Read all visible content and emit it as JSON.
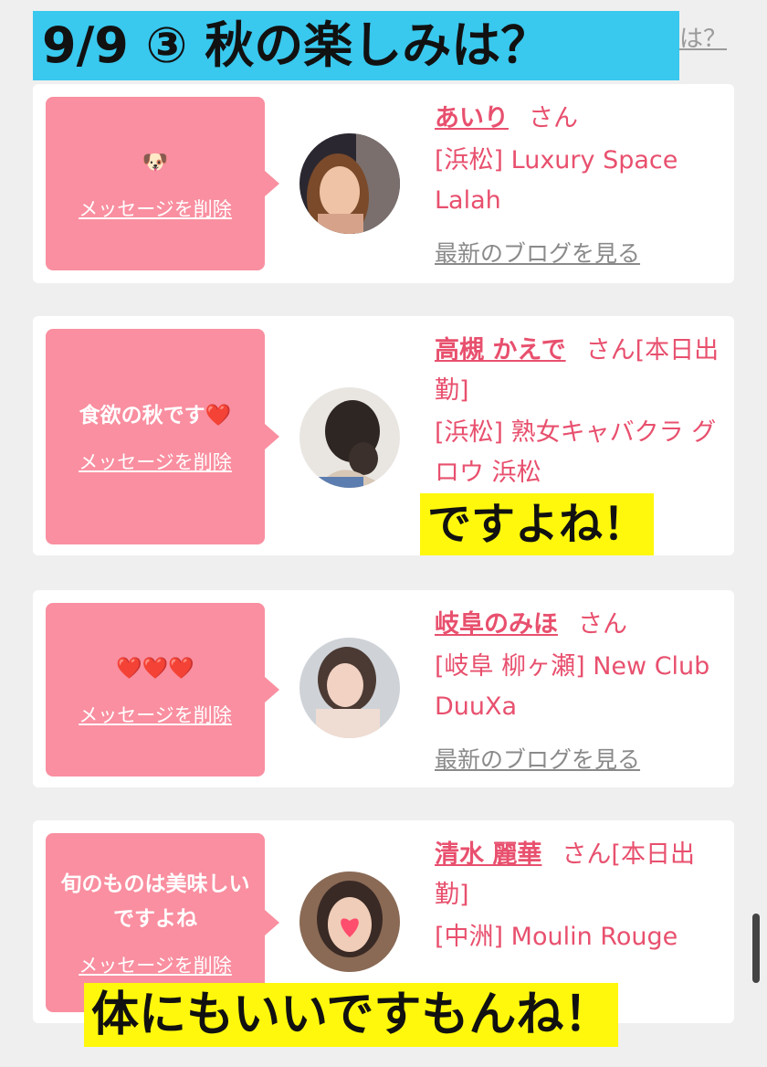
{
  "title_banner": "9/9 ③ 秋の楽しみは？",
  "background_text": "は？",
  "entries": [
    {
      "message": "🐶",
      "delete_label": "メッセージを削除",
      "name": "あいり",
      "honorific": "さん",
      "shop": "[浜松] Luxury Space Lalah",
      "blog_link": "最新のブログを見る"
    },
    {
      "message": "食欲の秋です❤️",
      "delete_label": "メッセージを削除",
      "name": "高槻 かえで",
      "honorific": "さん[本日出勤]",
      "shop": "[浜松] 熟女キャバクラ グロウ 浜松",
      "blog_link": ""
    },
    {
      "message": "❤️❤️❤️",
      "delete_label": "メッセージを削除",
      "name": "岐阜のみほ",
      "honorific": "さん",
      "shop": "[岐阜 柳ヶ瀬] New Club DuuXa",
      "blog_link": "最新のブログを見る"
    },
    {
      "message": "旬のものは美味しいですよね",
      "delete_label": "メッセージを削除",
      "name": "清水 麗華",
      "honorific": "さん[本日出勤]",
      "shop": "[中洲] Moulin Rouge",
      "blog_link": ""
    }
  ],
  "captions": {
    "top": "ですよね！",
    "bottom": "体にもいいですもんね！"
  },
  "colors": {
    "banner": "#39c8ee",
    "bubble": "#f98fa0",
    "link": "#e8506e",
    "caption": "#fff80c"
  }
}
